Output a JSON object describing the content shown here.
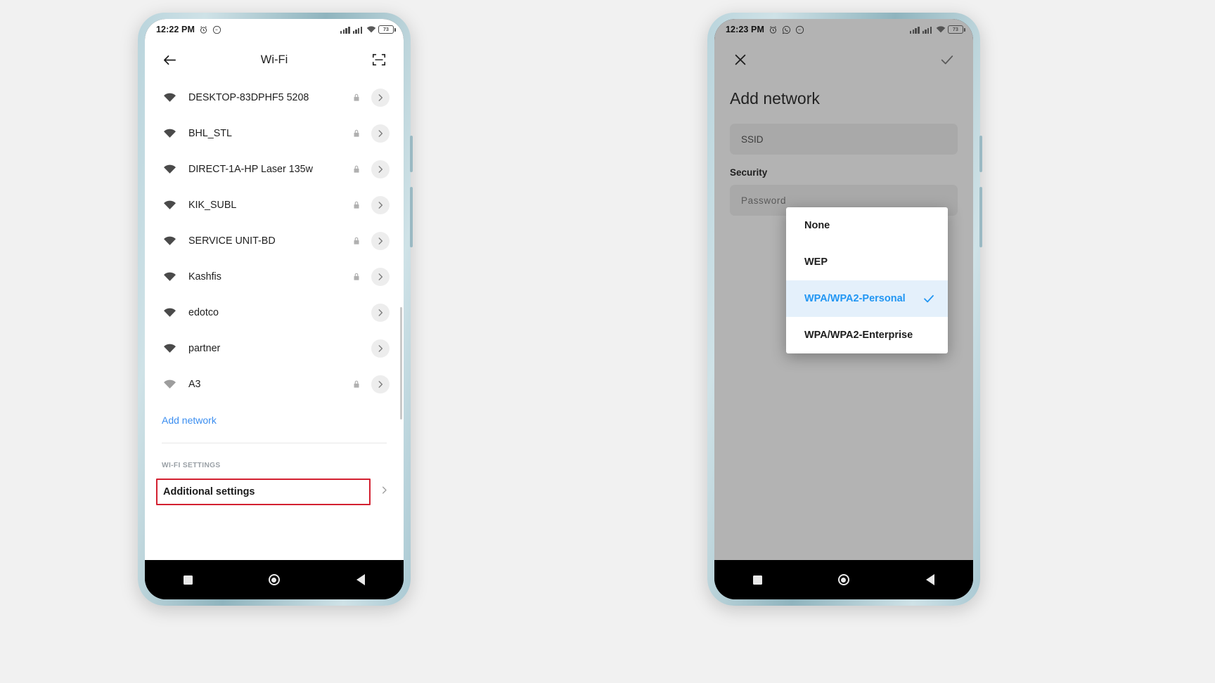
{
  "canvas": {
    "background": "#f1f1f1",
    "accent_blue": "#3b8ef0",
    "highlight_red": "#d32030"
  },
  "left_phone": {
    "status_bar": {
      "time": "12:22 PM",
      "icons": [
        "alarm-icon",
        "messenger-icon"
      ],
      "right_icons": [
        "signal-bars-sim1",
        "signal-bars-sim2",
        "wifi-icon"
      ],
      "battery_text": "73"
    },
    "action_bar": {
      "back": "back-arrow-icon",
      "title": "Wi-Fi",
      "scan": "qr-scan-icon"
    },
    "networks": [
      {
        "name": "DESKTOP-83DPHF5 5208",
        "secured": true
      },
      {
        "name": "BHL_STL",
        "secured": true
      },
      {
        "name": "DIRECT-1A-HP Laser 135w",
        "secured": true
      },
      {
        "name": "KIK_SUBL",
        "secured": true
      },
      {
        "name": "SERVICE UNIT-BD",
        "secured": true
      },
      {
        "name": "Kashfis",
        "secured": true
      },
      {
        "name": "edotco",
        "secured": false
      },
      {
        "name": "partner",
        "secured": false
      },
      {
        "name": "A3",
        "secured": true
      }
    ],
    "add_network_label": "Add network",
    "section_label": "WI-FI SETTINGS",
    "additional_settings_label": "Additional settings"
  },
  "right_phone": {
    "status_bar": {
      "time": "12:23 PM",
      "icons": [
        "alarm-icon",
        "whatsapp-icon",
        "messenger-icon"
      ],
      "right_icons": [
        "signal-bars-sim1",
        "signal-bars-sim2",
        "wifi-icon"
      ],
      "battery_text": "73"
    },
    "action_bar": {
      "close": "close-x-icon",
      "confirm": "checkmark-icon"
    },
    "title": "Add network",
    "ssid_placeholder": "SSID",
    "security_label": "Security",
    "password_placeholder": "Password",
    "security_dropdown": {
      "options": [
        "None",
        "WEP",
        "WPA/WPA2-Personal",
        "WPA/WPA2-Enterprise"
      ],
      "selected": "WPA/WPA2-Personal",
      "selected_index": 2,
      "check_icon": "checkmark-icon"
    }
  },
  "nav_bar": {
    "recents": "square-icon",
    "home": "circle-icon",
    "back": "triangle-back-icon"
  }
}
